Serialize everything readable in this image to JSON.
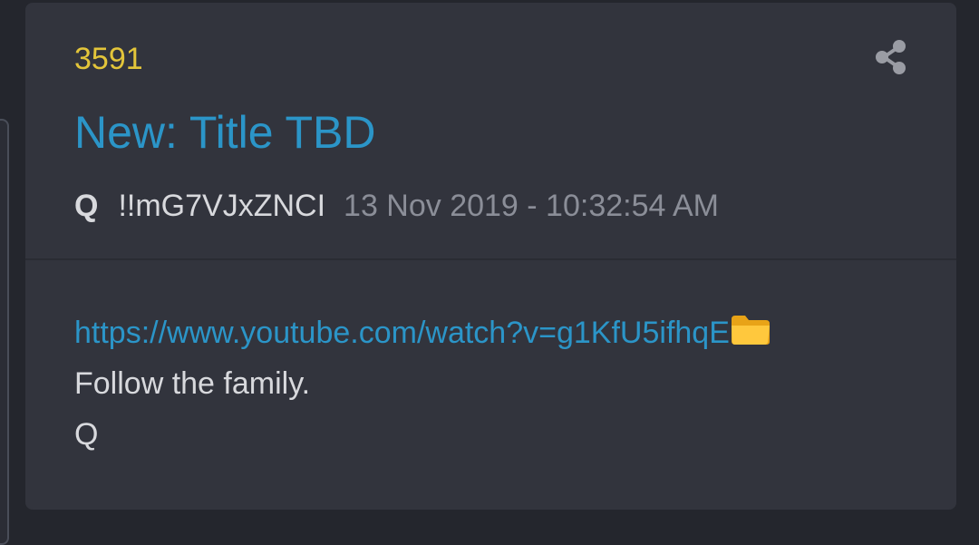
{
  "post": {
    "number": "3591",
    "title": "New: Title TBD",
    "author": "Q",
    "tripcode": "!!mG7VJxZNCI",
    "timestamp": "13 Nov 2019 - 10:32:54 AM",
    "link": "https://www.youtube.com/watch?v=g1KfU5ifhqE",
    "lines": [
      "Follow the family.",
      "Q"
    ]
  },
  "icons": {
    "share": "share-icon",
    "folder": "folder-icon"
  },
  "colors": {
    "background": "#24262d",
    "card": "#32343d",
    "post_number": "#e3c53a",
    "link": "#2b95c8",
    "text": "#d8d9dd",
    "muted": "#8b8e98"
  }
}
